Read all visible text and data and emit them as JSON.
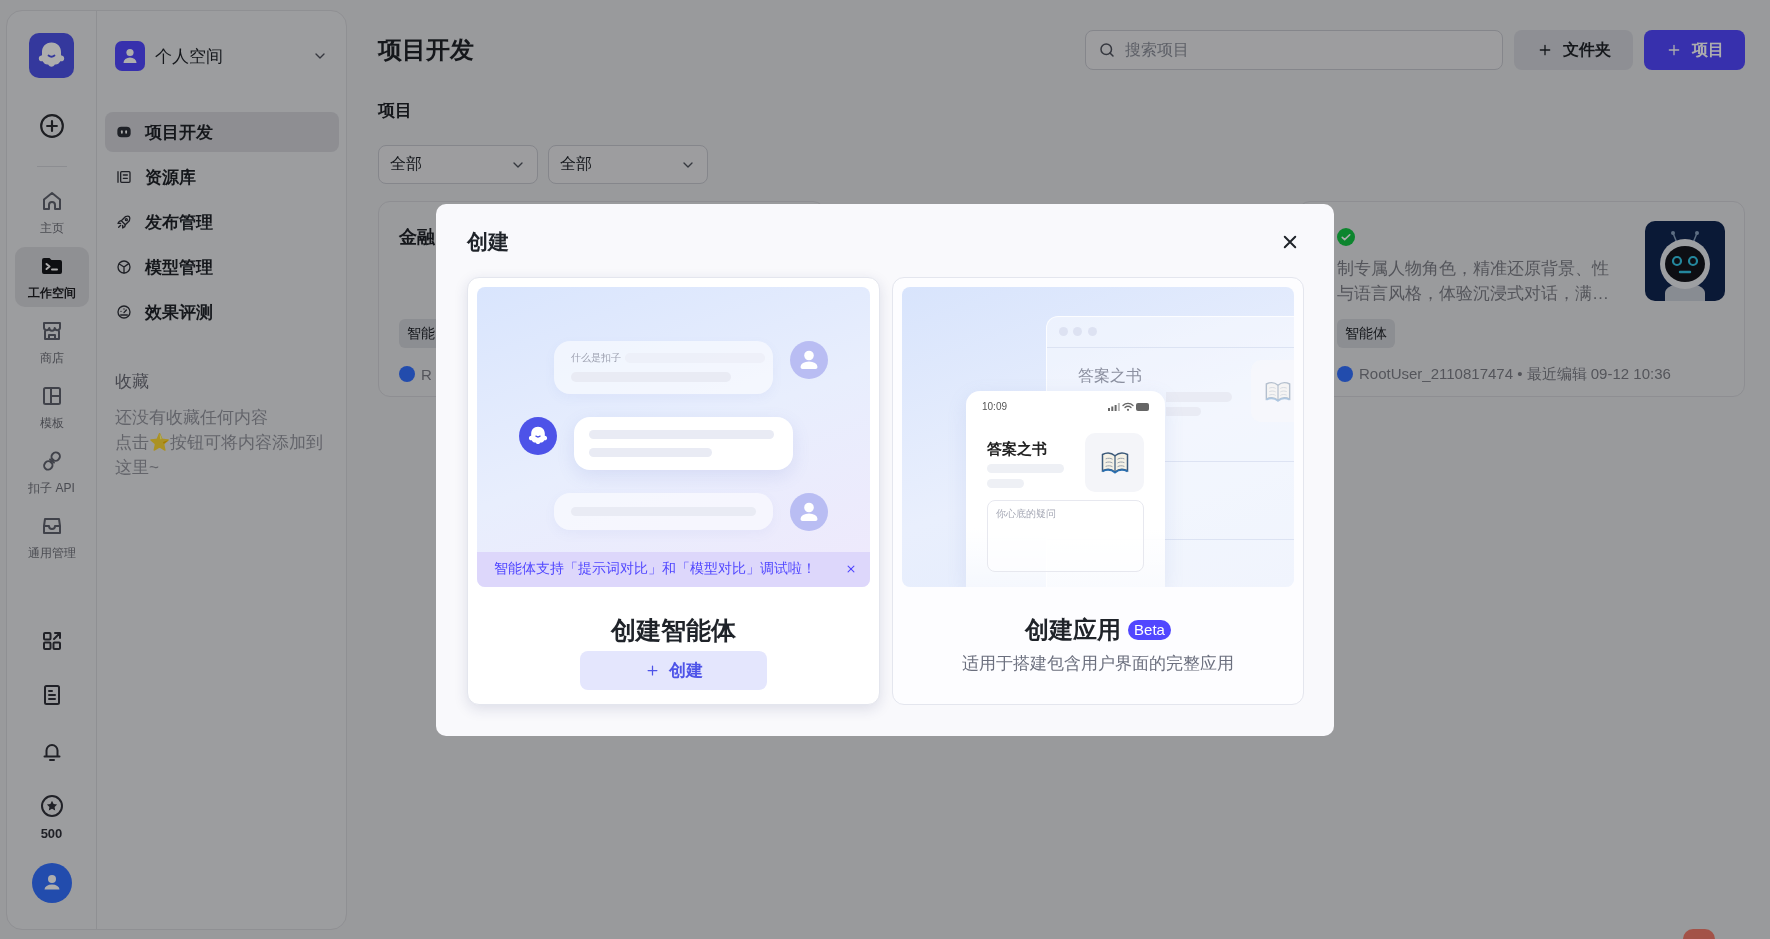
{
  "rail": {
    "nav": [
      {
        "label": "主页",
        "selected": false
      },
      {
        "label": "工作空间",
        "selected": true
      },
      {
        "label": "商店",
        "selected": false
      },
      {
        "label": "模板",
        "selected": false
      },
      {
        "label": "扣子 API",
        "selected": false
      },
      {
        "label": "通用管理",
        "selected": false
      }
    ],
    "credits": "500"
  },
  "sidebar": {
    "space": "个人空间",
    "nav": [
      {
        "label": "项目开发",
        "selected": true
      },
      {
        "label": "资源库",
        "selected": false
      },
      {
        "label": "发布管理",
        "selected": false
      },
      {
        "label": "模型管理",
        "selected": false
      },
      {
        "label": "效果评测",
        "selected": false
      }
    ],
    "favorites": {
      "title": "收藏",
      "empty_text": [
        "还没有收藏任何内容",
        "点击⭐按钮可将内容添加到这里~"
      ]
    }
  },
  "header": {
    "title": "项目开发",
    "search": {
      "placeholder": "搜索项目"
    },
    "buttons": [
      {
        "label": "文件夹",
        "kind": "secondary"
      },
      {
        "label": "项目",
        "kind": "primary"
      }
    ]
  },
  "section_title": "项目",
  "filters": [
    {
      "value": "全部"
    },
    {
      "value": "全部"
    }
  ],
  "projects": [
    {
      "title": "金融",
      "tag": "智能",
      "meta": "R"
    },
    {
      "published": true,
      "description": [
        "制专属人物角色，精准还原背景、性",
        "与语言风格，体验沉浸式对话，满…"
      ],
      "tag": "智能体",
      "meta": "RootUser_2110817474 • 最近编辑 09-12 10:36",
      "thumbnail": true
    }
  ],
  "dialog": {
    "title": "创建",
    "options": [
      {
        "kind": "agent",
        "hovered": true,
        "illustration": {
          "question": "什么是扣子",
          "notice": "智能体支持「提示词对比」和「模型对比」调试啦！"
        },
        "title": "创建智能体",
        "button": "创建"
      },
      {
        "kind": "app",
        "hovered": false,
        "illustration": {
          "window_title": "答案之书",
          "time": "10:09",
          "app_title": "答案之书",
          "input_placeholder": "你心底的疑问"
        },
        "title": "创建应用",
        "badge": "Beta",
        "description": "适用于搭建包含用户界面的完整应用"
      }
    ]
  }
}
